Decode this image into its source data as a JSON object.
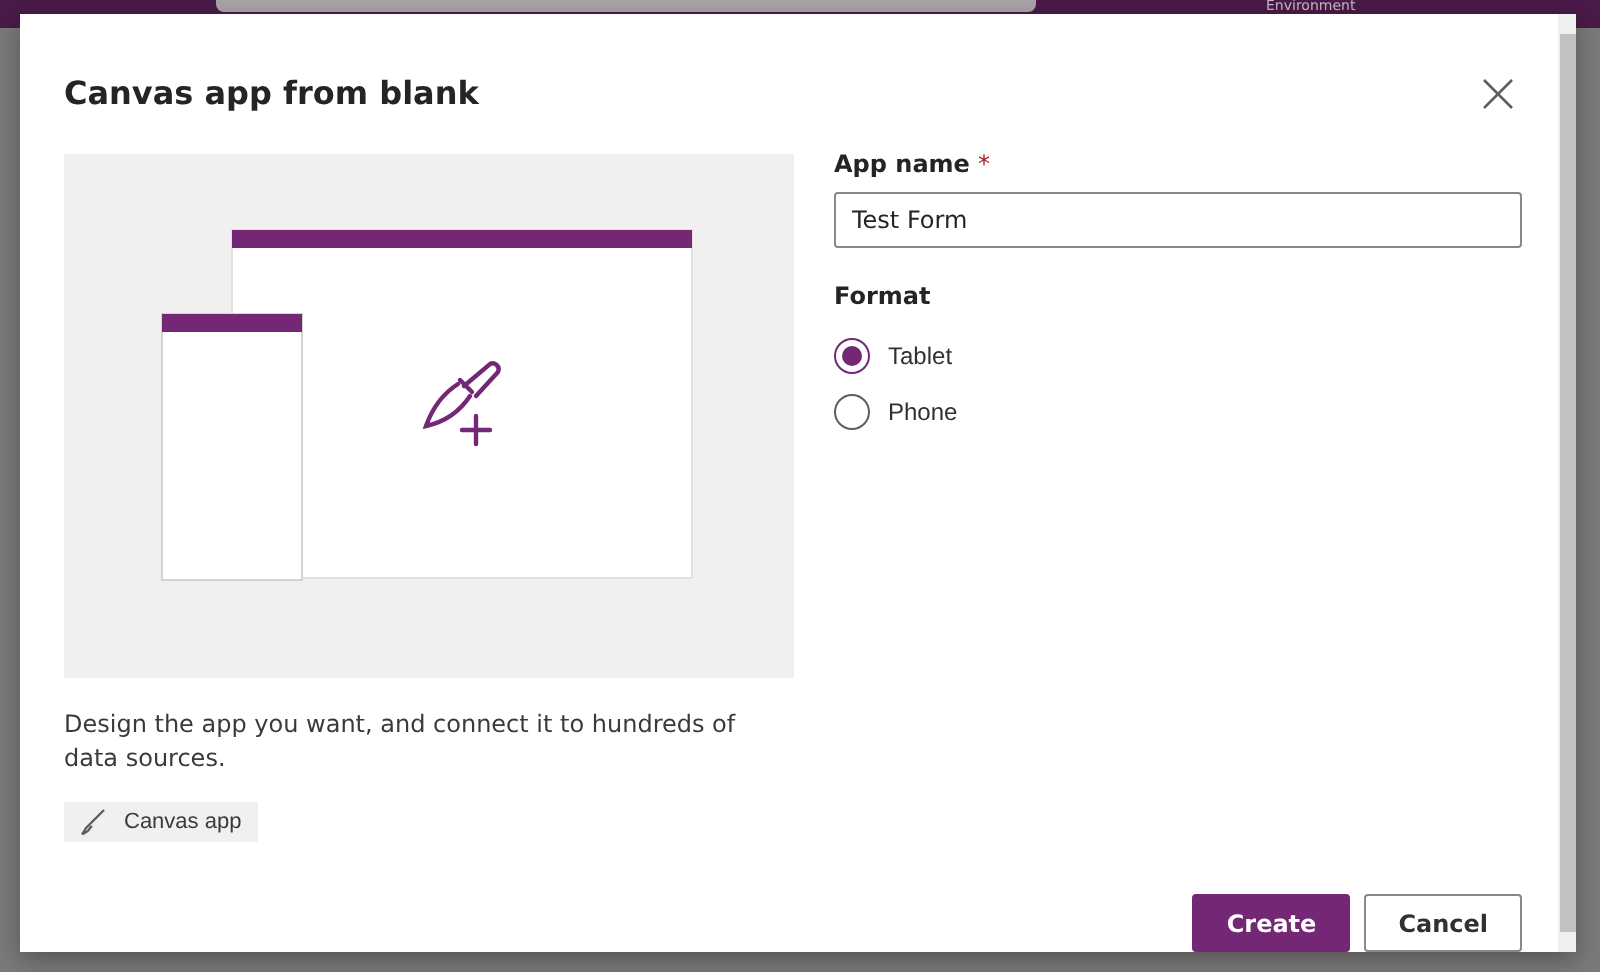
{
  "background": {
    "header_text": "Environment"
  },
  "dialog": {
    "title": "Canvas app from blank",
    "description": "Design the app you want, and connect it to hundreds of data sources.",
    "tag": "Canvas app",
    "app_name": {
      "label": "App name",
      "required_mark": "*",
      "value": "Test Form"
    },
    "format": {
      "label": "Format",
      "options": [
        {
          "label": "Tablet",
          "selected": true
        },
        {
          "label": "Phone",
          "selected": false
        }
      ]
    },
    "buttons": [
      {
        "label": "Create",
        "kind": "primary"
      },
      {
        "label": "Cancel",
        "kind": "secondary"
      }
    ]
  }
}
